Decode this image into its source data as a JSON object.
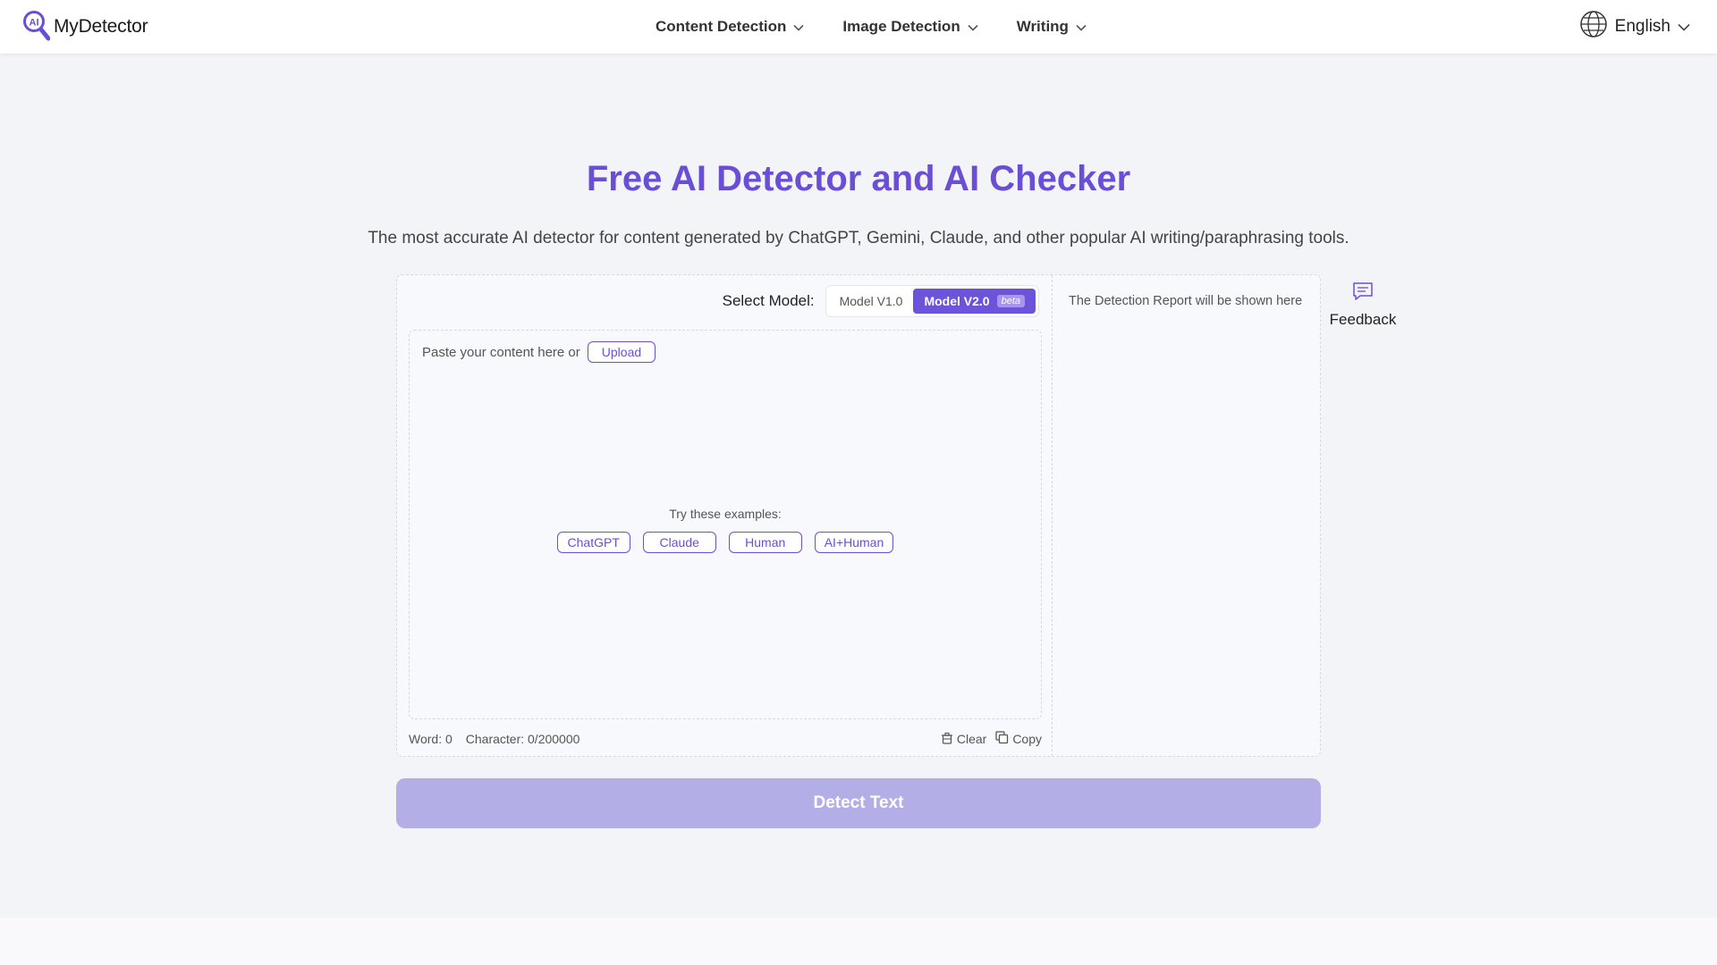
{
  "header": {
    "logo_text": "MyDetector",
    "nav": [
      {
        "label": "Content Detection"
      },
      {
        "label": "Image Detection"
      },
      {
        "label": "Writing"
      }
    ],
    "language": "English"
  },
  "hero": {
    "title": "Free AI Detector and AI Checker",
    "subtitle": "The most accurate AI detector for content generated by ChatGPT, Gemini, Claude, and other popular AI writing/paraphrasing tools."
  },
  "model": {
    "label": "Select Model:",
    "options": [
      "Model V1.0",
      "Model V2.0"
    ],
    "selected": "Model V2.0",
    "beta_badge": "beta"
  },
  "editor": {
    "paste_text": "Paste your content here or",
    "upload_label": "Upload",
    "examples_label": "Try these examples:",
    "examples": [
      "ChatGPT",
      "Claude",
      "Human",
      "AI+Human"
    ],
    "word_count": "Word: 0",
    "char_count": "Character: 0/200000",
    "clear_label": "Clear",
    "copy_label": "Copy"
  },
  "report": {
    "placeholder": "The Detection Report will be shown here"
  },
  "feedback": {
    "label": "Feedback"
  },
  "detect": {
    "label": "Detect Text"
  },
  "colors": {
    "accent": "#6a4fd6",
    "button_disabled": "#b4aee6",
    "background": "#f3f4f8"
  },
  "icons": {
    "logo": "magnifier-ai-icon",
    "nav_chevron": "chevron-down-icon",
    "language": "globe-icon",
    "clear": "trash-icon",
    "copy": "copy-icon",
    "feedback": "chat-bubble-icon"
  }
}
